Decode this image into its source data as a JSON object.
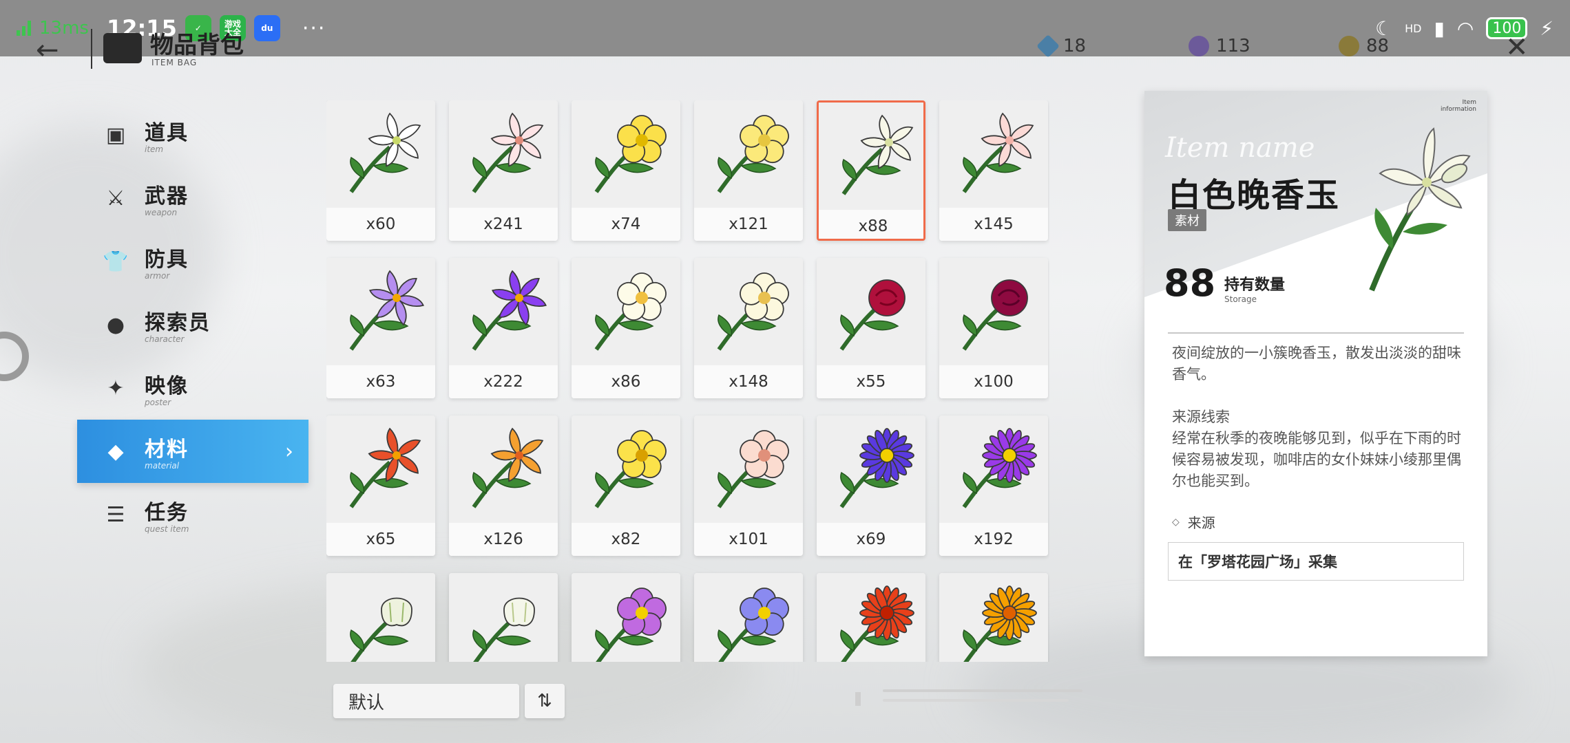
{
  "status_bar": {
    "network": "13ms",
    "time": "12:15",
    "app_badge_2": "游戏\n大全",
    "more": "···",
    "hd": "HD",
    "battery": "100"
  },
  "header": {
    "back": "←",
    "title": "物品背包",
    "subtitle": "ITEM BAG",
    "close": "✕",
    "currencies": [
      {
        "value": "18",
        "color": "#4a7fa6"
      },
      {
        "value": "113",
        "color": "#6c5a9a"
      },
      {
        "value": "88",
        "color": "#8a7a3a"
      }
    ]
  },
  "nav": {
    "items": [
      {
        "label": "道具",
        "sub": "item",
        "icon": "box-icon"
      },
      {
        "label": "武器",
        "sub": "weapon",
        "icon": "sword-icon"
      },
      {
        "label": "防具",
        "sub": "armor",
        "icon": "shirt-icon"
      },
      {
        "label": "探索员",
        "sub": "character",
        "icon": "character-icon"
      },
      {
        "label": "映像",
        "sub": "poster",
        "icon": "poster-icon"
      },
      {
        "label": "材料",
        "sub": "material",
        "icon": "material-icon"
      },
      {
        "label": "任务",
        "sub": "quest item",
        "icon": "quest-icon"
      }
    ],
    "active_index": 5,
    "arrow": "›"
  },
  "items": [
    {
      "count": "x60",
      "flower": "lily",
      "petal": "#ffffff",
      "center": "#c9d96a"
    },
    {
      "count": "x241",
      "flower": "lily",
      "petal": "#fde4e6",
      "center": "#e08a7a"
    },
    {
      "count": "x74",
      "flower": "trumpet",
      "petal": "#fbe04a",
      "center": "#e0b800"
    },
    {
      "count": "x121",
      "flower": "trumpet",
      "petal": "#fbe97a",
      "center": "#e6c640"
    },
    {
      "count": "x88",
      "flower": "tuberose",
      "petal": "#f7f7e8",
      "center": "#d8e0a0"
    },
    {
      "count": "x145",
      "flower": "tuberose",
      "petal": "#fbdad6",
      "center": "#f2b0a6"
    },
    {
      "count": "x63",
      "flower": "crocus",
      "petal": "#b58ef0",
      "center": "#f2a800"
    },
    {
      "count": "x222",
      "flower": "crocus",
      "petal": "#8a3ff0",
      "center": "#f2a800"
    },
    {
      "count": "x86",
      "flower": "primrose",
      "petal": "#fdfbe8",
      "center": "#f0c040"
    },
    {
      "count": "x148",
      "flower": "primrose",
      "petal": "#fcf8de",
      "center": "#e8c050"
    },
    {
      "count": "x55",
      "flower": "rose",
      "petal": "#b0103c",
      "center": "#7a0020"
    },
    {
      "count": "x100",
      "flower": "rose",
      "petal": "#8e0a40",
      "center": "#5a0028"
    },
    {
      "count": "x65",
      "flower": "star",
      "petal": "#e8502a",
      "center": "#f2a000"
    },
    {
      "count": "x126",
      "flower": "star",
      "petal": "#f5a030",
      "center": "#e06020"
    },
    {
      "count": "x82",
      "flower": "primrose",
      "petal": "#fbe24a",
      "center": "#d8a000"
    },
    {
      "count": "x101",
      "flower": "primrose",
      "petal": "#fbdcd0",
      "center": "#e0907a"
    },
    {
      "count": "x69",
      "flower": "aster",
      "petal": "#5a3ae0",
      "center": "#f2d000"
    },
    {
      "count": "x192",
      "flower": "aster",
      "petal": "#9a3ae8",
      "center": "#f2d000"
    },
    {
      "count": "",
      "flower": "bell",
      "petal": "#eef2de",
      "center": "#9ab86a"
    },
    {
      "count": "",
      "flower": "bell",
      "petal": "#f4f6ea",
      "center": "#b8c88a"
    },
    {
      "count": "",
      "flower": "iris",
      "petal": "#c06ae0",
      "center": "#f2d000"
    },
    {
      "count": "",
      "flower": "iris",
      "petal": "#8a8af0",
      "center": "#f2d000"
    },
    {
      "count": "",
      "flower": "marigold",
      "petal": "#e8401a",
      "center": "#c02000"
    },
    {
      "count": "",
      "flower": "marigold",
      "petal": "#f5a000",
      "center": "#e06000"
    }
  ],
  "selected_index": 4,
  "bottom": {
    "sort_label": "默认",
    "sort_toggle": "⇅"
  },
  "info": {
    "badge": "Item\ninformation",
    "script_label": "Item name",
    "name": "白色晚香玉",
    "tag": "素材",
    "storage_value": "88",
    "storage_label": "持有数量",
    "storage_sub": "Storage",
    "description": "夜间绽放的一小簇晚香玉，散发出淡淡的甜味香气。",
    "hint_title": "来源线索",
    "hint": "经常在秋季的夜晚能够见到，似乎在下雨的时候容易被发现，咖啡店的女仆妹妹小绫那里偶尔也能买到。",
    "source_head": "来源",
    "source_diamond": "◇",
    "source": "在「罗塔花园广场」采集"
  }
}
